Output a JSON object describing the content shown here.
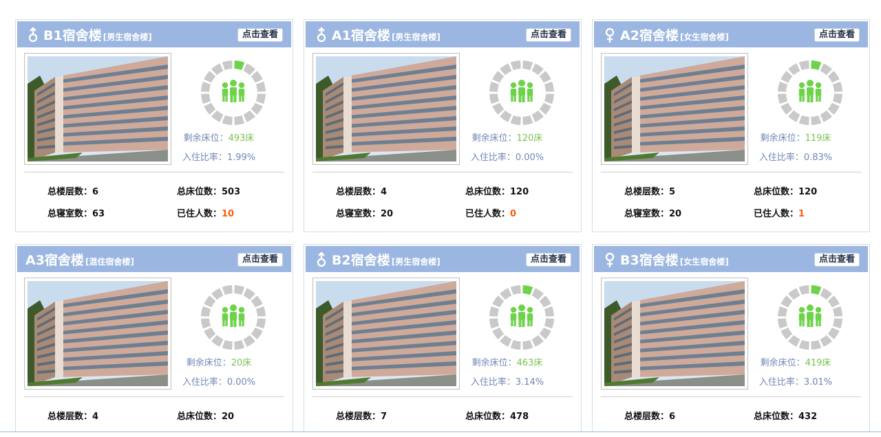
{
  "colors": {
    "header": "#9bb6e1",
    "remaining": "#79c24f",
    "muted": "#6f87b4",
    "occupied": "#ff5a00",
    "ring_off": "#c9c9c9",
    "ring_on": "#6ed34b"
  },
  "labels": {
    "view": "点击查看",
    "remaining": "剩余床位：",
    "rate": "入住比率：",
    "floors": "总楼层数：",
    "beds": "总床位数：",
    "rooms": "总寝室数：",
    "occupants": "已住人数："
  },
  "buildings": [
    {
      "gender_icon": "male-icon",
      "name": "B1宿舍楼",
      "type": "[男生宿舍楼]",
      "remaining": "493床",
      "rate": "1.99%",
      "floors": "6",
      "beds": "503",
      "rooms": "63",
      "occupants": "10",
      "occupancy_ratio": 0.0199
    },
    {
      "gender_icon": "male-icon",
      "name": "A1宿舍楼",
      "type": "[男生宿舍楼]",
      "remaining": "120床",
      "rate": "0.00%",
      "floors": "4",
      "beds": "120",
      "rooms": "20",
      "occupants": "0",
      "occupancy_ratio": 0
    },
    {
      "gender_icon": "female-icon",
      "name": "A2宿舍楼",
      "type": "[女生宿舍楼]",
      "remaining": "119床",
      "rate": "0.83%",
      "floors": "5",
      "beds": "120",
      "rooms": "20",
      "occupants": "1",
      "occupancy_ratio": 0.0083
    },
    {
      "gender_icon": "",
      "name": "A3宿舍楼",
      "type": "[混住宿舍楼]",
      "remaining": "20床",
      "rate": "0.00%",
      "floors": "4",
      "beds": "20",
      "rooms": "",
      "occupants": "",
      "occupancy_ratio": 0
    },
    {
      "gender_icon": "male-icon",
      "name": "B2宿舍楼",
      "type": "[男生宿舍楼]",
      "remaining": "463床",
      "rate": "3.14%",
      "floors": "7",
      "beds": "478",
      "rooms": "",
      "occupants": "",
      "occupancy_ratio": 0.0314
    },
    {
      "gender_icon": "female-icon",
      "name": "B3宿舍楼",
      "type": "[女生宿舍楼]",
      "remaining": "419床",
      "rate": "3.01%",
      "floors": "6",
      "beds": "432",
      "rooms": "",
      "occupants": "",
      "occupancy_ratio": 0.0301
    }
  ]
}
